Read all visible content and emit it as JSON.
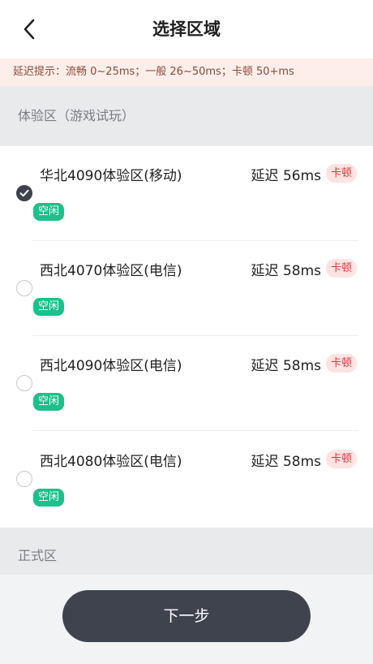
{
  "header": {
    "title": "选择区域"
  },
  "latency_tip": "延迟提示：流畅 0~25ms；一般 26~50ms；卡顿 50+ms",
  "sections": [
    {
      "label": "体验区（游戏试玩）"
    },
    {
      "label": "正式区"
    }
  ],
  "servers": [
    {
      "name": "华北4090体验区(移动)",
      "latency": "延迟 56ms",
      "lag_label": "卡顿",
      "status": "空闲",
      "selected": true
    },
    {
      "name": "西北4070体验区(电信)",
      "latency": "延迟 58ms",
      "lag_label": "卡顿",
      "status": "空闲",
      "selected": false
    },
    {
      "name": "西北4090体验区(电信)",
      "latency": "延迟 58ms",
      "lag_label": "卡顿",
      "status": "空闲",
      "selected": false
    },
    {
      "name": "西北4080体验区(电信)",
      "latency": "延迟 58ms",
      "lag_label": "卡顿",
      "status": "空闲",
      "selected": false
    }
  ],
  "next_button": "下一步",
  "colors": {
    "accent_dark": "#3f434e",
    "status_green": "#19c28a",
    "lag_red": "#d23c3c",
    "tip_background": "#fdeeea"
  }
}
